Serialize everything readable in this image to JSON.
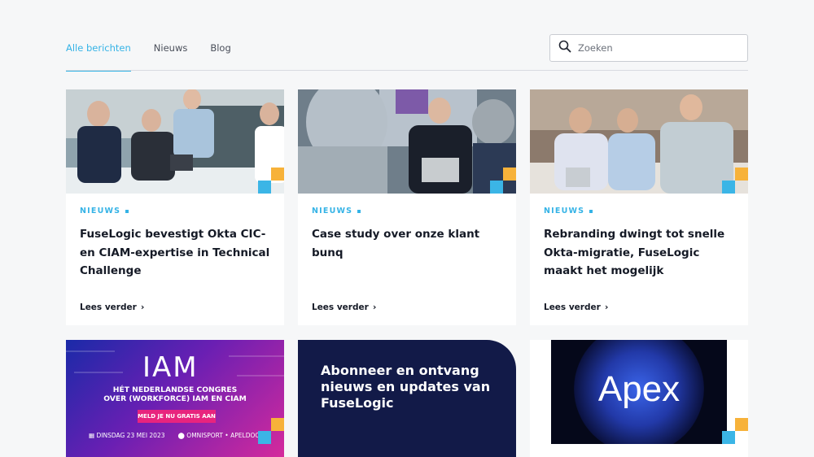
{
  "tabs": [
    {
      "label": "Alle berichten",
      "active": true
    },
    {
      "label": "Nieuws",
      "active": false
    },
    {
      "label": "Blog",
      "active": false
    }
  ],
  "search": {
    "placeholder": "Zoeken",
    "icon": "search-icon"
  },
  "cards": [
    {
      "tag": "NIEUWS",
      "title": "FuseLogic bevestigt Okta CIC- en CIAM-expertise in Technical Challenge",
      "more": "Lees verder"
    },
    {
      "tag": "NIEUWS",
      "title": "Case study over onze klant bunq",
      "more": "Lees verder"
    },
    {
      "tag": "NIEUWS",
      "title": "Rebranding dwingt tot snelle Okta-migratie, FuseLogic maakt het mogelijk",
      "more": "Lees verder"
    }
  ],
  "iam_banner": {
    "logo": "IAM",
    "headline_1": "HÉT NEDERLANDSE CONGRES",
    "headline_2": "OVER (WORKFORCE) IAM EN CIAM",
    "cta": "MELD JE NU GRATIS AAN",
    "date": "DINSDAG 23 MEI 2023",
    "location": "OMNISPORT • APELDOORN"
  },
  "newsletter": {
    "title": "Abonneer en ontvang nieuws en updates van FuseLogic"
  },
  "apex": {
    "word": "Apex"
  },
  "colors": {
    "accent": "#35b3e6",
    "orange": "#f7b23a",
    "navy": "#121a48"
  }
}
